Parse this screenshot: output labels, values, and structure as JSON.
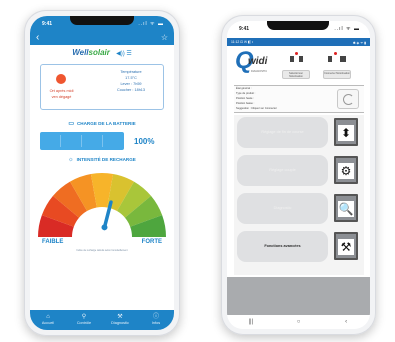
{
  "left_phone": {
    "status": {
      "time": "9:41",
      "signal": "..ıl ᯤ ▬"
    },
    "appbar": {
      "back_icon": "‹",
      "star_icon": "☆"
    },
    "logo": {
      "part1": "Well",
      "part2": "solair",
      "icons": "◀)) ☰"
    },
    "info": {
      "sun_text_1": "Ort après midi",
      "sun_text_2": "ven dégagé",
      "meteo_title": "Température",
      "meteo_temp": "17.5°C",
      "meteo_lever": "Lever : 7h59",
      "meteo_coucher": "Coucher : 18h13"
    },
    "battery": {
      "title": "CHARGE DE LA BATTERIE",
      "percent": "100%"
    },
    "recharge": {
      "title": "INTENSITÉ DE RECHARGE",
      "level": 0.58
    },
    "gauge_labels": {
      "low": "FAIBLE",
      "high": "FORTE",
      "caption": "Indice de recharge calculé selon l'ensoleillement"
    },
    "nav": [
      {
        "icon": "⌂",
        "label": "Accueil"
      },
      {
        "icon": "⚲",
        "label": "Contrôle"
      },
      {
        "icon": "⚒",
        "label": "Diagnostic"
      },
      {
        "icon": "ⓘ",
        "label": "Infos"
      }
    ],
    "colors": {
      "primary": "#1e84c7",
      "battery": "#45aae7",
      "sun": "#ef5630"
    }
  },
  "right_phone": {
    "status": {
      "time": "9:41",
      "signal": "..ıl ᯤ ▬"
    },
    "android_bar": {
      "left": "11:12 ⊡ ✉ ◧ •",
      "right": "✱ ◈ ᯤ ▮"
    },
    "logo": {
      "q": "Q",
      "rest": "widi",
      "sub": "DIAGNOSTIC"
    },
    "header_buttons": [
      "Sélectionner Motorisation",
      "Connecter Motorisation"
    ],
    "status_lines": [
      "État général :",
      "Type de produit :",
      "Position haute :",
      "Position basse :",
      "Suggestion :   Cliquez sur Connecter"
    ],
    "functions": [
      {
        "label": "Réglage de fin de course",
        "icon": "⬍",
        "active": false
      },
      {
        "label": "Réglage couple",
        "icon": "⚙",
        "active": false
      },
      {
        "label": "Diagnostic",
        "icon": "🔍",
        "active": false
      },
      {
        "label": "Fonctions avancées",
        "icon": "⚒",
        "active": true
      }
    ],
    "android_nav": [
      "|||",
      "○",
      "‹"
    ]
  }
}
